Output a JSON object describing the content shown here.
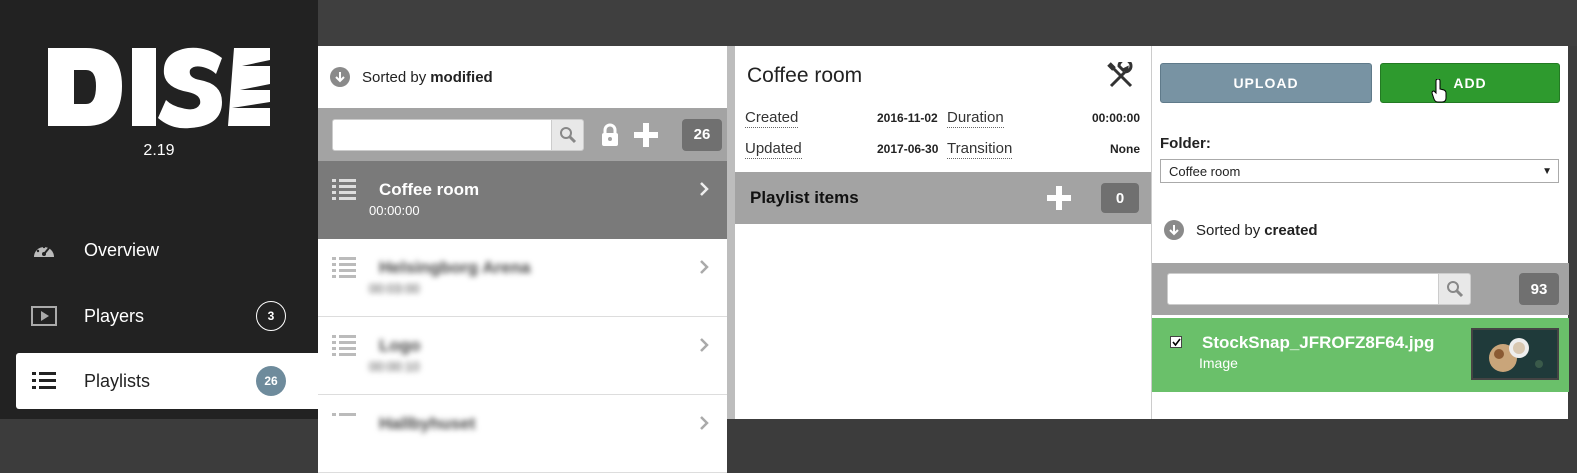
{
  "sidebar": {
    "version": "2.19",
    "items": [
      {
        "label": "Overview",
        "icon": "dashboard-icon",
        "badge": ""
      },
      {
        "label": "Players",
        "icon": "play-icon",
        "badge": "3"
      },
      {
        "label": "Playlists",
        "icon": "list-icon",
        "badge": "26"
      }
    ]
  },
  "playlists": {
    "sort_prefix": "Sorted by",
    "sort_field": "modified",
    "count": "26",
    "items": [
      {
        "title": "Coffee room",
        "duration": "00:00:00"
      },
      {
        "title": "Helsingborg Arena",
        "duration": "00:03:00"
      },
      {
        "title": "Logo",
        "duration": "00:00:10"
      },
      {
        "title": "Hallbyhuset",
        "duration": ""
      }
    ]
  },
  "detail": {
    "title": "Coffee room",
    "created_label": "Created",
    "created_value": "2016-11-02",
    "duration_label": "Duration",
    "duration_value": "00:00:00",
    "updated_label": "Updated",
    "updated_value": "2017-06-30",
    "transition_label": "Transition",
    "transition_value": "None",
    "items_label": "Playlist items",
    "items_count": "0"
  },
  "media": {
    "upload_label": "UPLOAD",
    "add_label": "ADD",
    "folder_label": "Folder:",
    "folder_value": "Coffee room",
    "sort_prefix": "Sorted by",
    "sort_field": "created",
    "count": "93",
    "items": [
      {
        "name": "StockSnap_JFROFZ8F64.jpg",
        "type": "Image"
      }
    ]
  },
  "colors": {
    "sidebar_bg": "#222222",
    "add_green": "#2e9a2e",
    "upload_blue": "#7893a3",
    "selected_media": "#6ac06a"
  }
}
